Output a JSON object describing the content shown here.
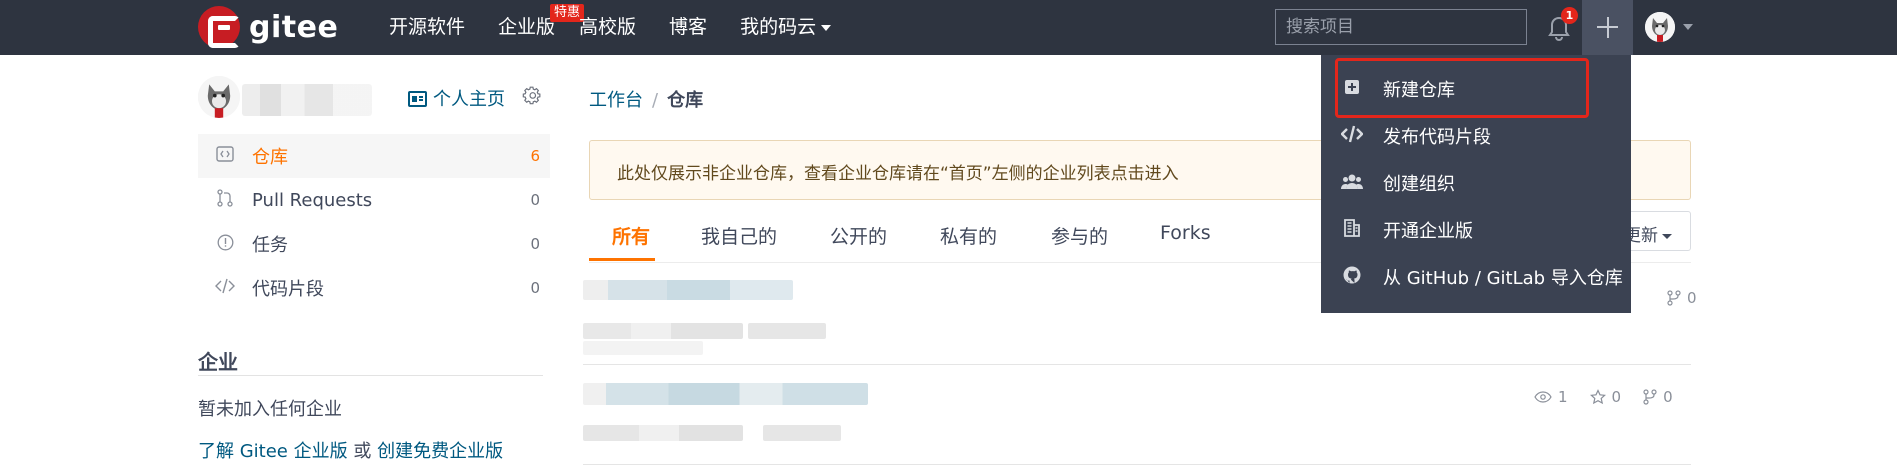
{
  "topbar": {
    "logo_text": "gitee",
    "nav": [
      {
        "label": "开源软件"
      },
      {
        "label": "企业版",
        "badge": "特惠"
      },
      {
        "label": "高校版"
      },
      {
        "label": "博客"
      },
      {
        "label": "我的码云"
      }
    ],
    "search_placeholder": "搜索项目",
    "notification_count": "1"
  },
  "dropdown": {
    "items": [
      {
        "label": "新建仓库",
        "icon": "plus-square-icon"
      },
      {
        "label": "发布代码片段",
        "icon": "code-icon"
      },
      {
        "label": "创建组织",
        "icon": "group-icon"
      },
      {
        "label": "开通企业版",
        "icon": "building-icon"
      },
      {
        "label": "从 GitHub / GitLab 导入仓库",
        "icon": "github-icon"
      }
    ]
  },
  "sidebar": {
    "homepage_label": "个人主页",
    "menu": [
      {
        "label": "仓库",
        "count": "6",
        "icon": "repo-icon"
      },
      {
        "label": "Pull Requests",
        "count": "0",
        "icon": "pull-request-icon"
      },
      {
        "label": "任务",
        "count": "0",
        "icon": "issue-icon"
      },
      {
        "label": "代码片段",
        "count": "0",
        "icon": "code-icon"
      }
    ],
    "enterprise": {
      "title": "企业",
      "empty_text": "暂未加入任何企业",
      "learn_link": "了解 Gitee 企业版",
      "or_text": "或",
      "create_link": "创建免费企业版"
    }
  },
  "main": {
    "breadcrumb": {
      "root": "工作台",
      "separator": "/",
      "current": "仓库"
    },
    "notice": "此处仅展示非企业仓库，查看企业仓库请在“首页”左侧的企业列表点击进入",
    "tabs": [
      "所有",
      "我自己的",
      "公开的",
      "私有的",
      "参与的",
      "Forks"
    ],
    "sort_label": "更新",
    "repos": [
      {
        "watch": "",
        "star": "",
        "fork": "0"
      },
      {
        "watch": "1",
        "star": "0",
        "fork": "0"
      }
    ]
  },
  "colors": {
    "topbar": "#2e3440",
    "accent": "#fe7300",
    "link": "#005980",
    "brand": "#c71d23",
    "dropdown": "#3b4252",
    "highlight": "#e3261b"
  }
}
